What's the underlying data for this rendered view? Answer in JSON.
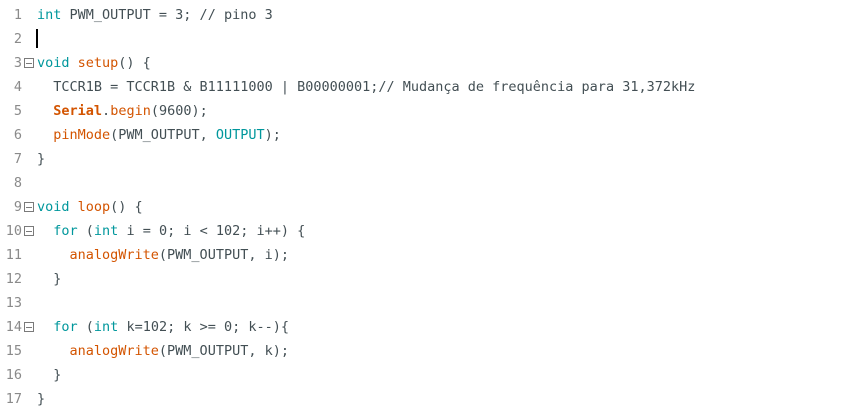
{
  "editor": {
    "lines": [
      {
        "no": "1",
        "parts": [
          {
            "t": "int",
            "c": "kw"
          },
          {
            "t": " PWM_OUTPUT = 3; // pino 3",
            "c": "plain"
          }
        ]
      },
      {
        "no": "2",
        "parts": []
      },
      {
        "no": "3",
        "fold": true,
        "parts": [
          {
            "t": "void",
            "c": "kw"
          },
          {
            "t": " ",
            "c": "plain"
          },
          {
            "t": "setup",
            "c": "fn"
          },
          {
            "t": "() {",
            "c": "plain"
          }
        ]
      },
      {
        "no": "4",
        "parts": [
          {
            "t": "  TCCR1B = TCCR1B & B11111000 | B00000001;// Mudança de frequência para 31,372kHz",
            "c": "plain"
          }
        ]
      },
      {
        "no": "5",
        "parts": [
          {
            "t": "  ",
            "c": "plain"
          },
          {
            "t": "Serial",
            "c": "obj"
          },
          {
            "t": ".",
            "c": "plain"
          },
          {
            "t": "begin",
            "c": "fn"
          },
          {
            "t": "(9600);",
            "c": "plain"
          }
        ]
      },
      {
        "no": "6",
        "parts": [
          {
            "t": "  ",
            "c": "plain"
          },
          {
            "t": "pinMode",
            "c": "fn"
          },
          {
            "t": "(PWM_OUTPUT, ",
            "c": "plain"
          },
          {
            "t": "OUTPUT",
            "c": "const"
          },
          {
            "t": ");",
            "c": "plain"
          }
        ]
      },
      {
        "no": "7",
        "parts": [
          {
            "t": "}",
            "c": "plain"
          }
        ]
      },
      {
        "no": "8",
        "parts": []
      },
      {
        "no": "9",
        "fold": true,
        "parts": [
          {
            "t": "void",
            "c": "kw"
          },
          {
            "t": " ",
            "c": "plain"
          },
          {
            "t": "loop",
            "c": "fn"
          },
          {
            "t": "() {",
            "c": "plain"
          }
        ]
      },
      {
        "no": "10",
        "fold": true,
        "parts": [
          {
            "t": "  ",
            "c": "plain"
          },
          {
            "t": "for",
            "c": "kw"
          },
          {
            "t": " (",
            "c": "plain"
          },
          {
            "t": "int",
            "c": "kw"
          },
          {
            "t": " i = 0; i < 102; i++) {",
            "c": "plain"
          }
        ]
      },
      {
        "no": "11",
        "parts": [
          {
            "t": "    ",
            "c": "plain"
          },
          {
            "t": "analogWrite",
            "c": "fn"
          },
          {
            "t": "(PWM_OUTPUT, i);",
            "c": "plain"
          }
        ]
      },
      {
        "no": "12",
        "parts": [
          {
            "t": "  }",
            "c": "plain"
          }
        ]
      },
      {
        "no": "13",
        "parts": []
      },
      {
        "no": "14",
        "fold": true,
        "parts": [
          {
            "t": "  ",
            "c": "plain"
          },
          {
            "t": "for",
            "c": "kw"
          },
          {
            "t": " (",
            "c": "plain"
          },
          {
            "t": "int",
            "c": "kw"
          },
          {
            "t": " k=102; k >= 0; k--){",
            "c": "plain"
          }
        ]
      },
      {
        "no": "15",
        "parts": [
          {
            "t": "    ",
            "c": "plain"
          },
          {
            "t": "analogWrite",
            "c": "fn"
          },
          {
            "t": "(PWM_OUTPUT, k);",
            "c": "plain"
          }
        ]
      },
      {
        "no": "16",
        "parts": [
          {
            "t": "  }",
            "c": "plain"
          }
        ]
      },
      {
        "no": "17",
        "parts": [
          {
            "t": "}",
            "c": "plain"
          }
        ]
      }
    ],
    "colors": {
      "keyword": "#00979c",
      "function": "#d35400",
      "text": "#434f54",
      "line_number": "#8a8a8a"
    }
  }
}
